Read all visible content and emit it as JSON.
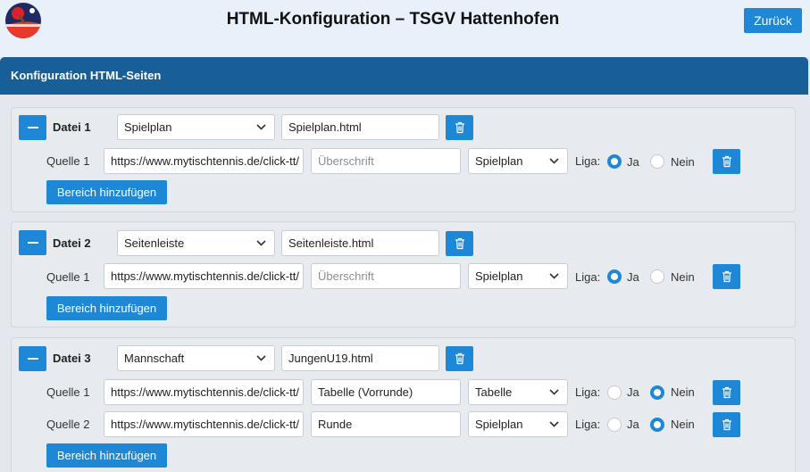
{
  "header": {
    "title": "HTML-Konfiguration – TSGV Hattenhofen",
    "back_label": "Zurück"
  },
  "panel": {
    "title": "Konfiguration HTML-Seiten",
    "add_area_label": "Bereich hinzufügen",
    "source_prefix": "Quelle",
    "liga_label": "Liga:",
    "yes_label": "Ja",
    "no_label": "Nein",
    "heading_placeholder": "Überschrift"
  },
  "files": [
    {
      "label": "Datei 1",
      "type": "Spielplan",
      "filename": "Spielplan.html",
      "sources": [
        {
          "label": "Quelle 1",
          "url": "https://www.mytischtennis.de/click-tt/",
          "heading": "",
          "type": "Spielplan",
          "liga": "Ja"
        }
      ]
    },
    {
      "label": "Datei 2",
      "type": "Seitenleiste",
      "filename": "Seitenleiste.html",
      "sources": [
        {
          "label": "Quelle 1",
          "url": "https://www.mytischtennis.de/click-tt/",
          "heading": "",
          "type": "Spielplan",
          "liga": "Ja"
        }
      ]
    },
    {
      "label": "Datei 3",
      "type": "Mannschaft",
      "filename": "JungenU19.html",
      "sources": [
        {
          "label": "Quelle 1",
          "url": "https://www.mytischtennis.de/click-tt/",
          "heading": "Tabelle (Vorrunde)",
          "type": "Tabelle",
          "liga": "Nein"
        },
        {
          "label": "Quelle 2",
          "url": "https://www.mytischtennis.de/click-tt/",
          "heading": "Runde",
          "type": "Spielplan",
          "liga": "Nein"
        }
      ]
    }
  ],
  "icons": {
    "collapse": "minus-icon",
    "delete": "trash-icon",
    "dropdown": "chevron-down-icon",
    "logo": "club-logo-icon"
  },
  "colors": {
    "accent": "#1e88d6",
    "panel_header": "#175f96",
    "topbar": "#e8f1fa",
    "background": "#e4e8ee"
  }
}
